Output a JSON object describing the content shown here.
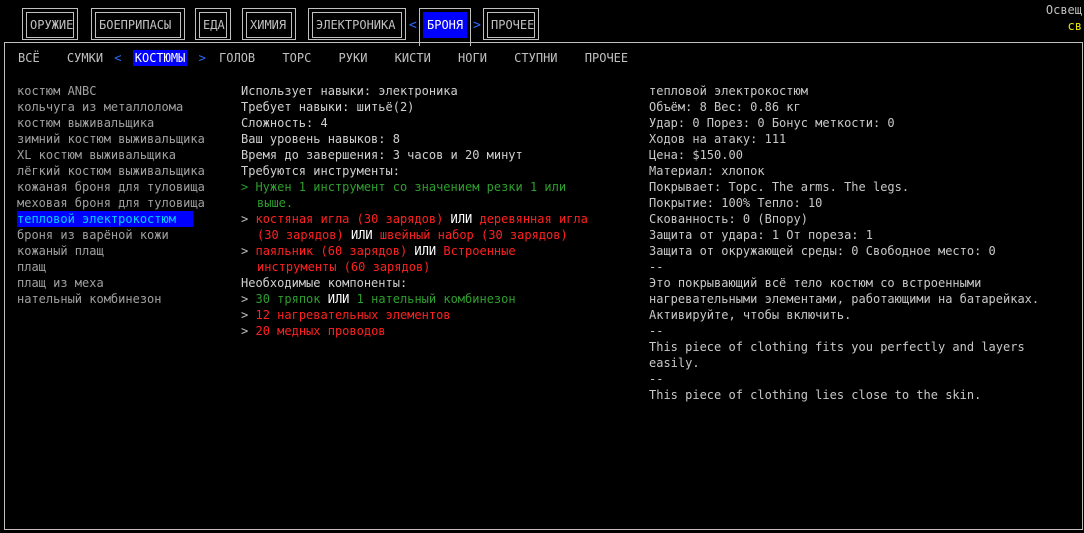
{
  "top_tabs": [
    {
      "label": "ОРУЖИЕ"
    },
    {
      "label": "БОЕПРИПАСЫ"
    },
    {
      "label": "ЕДА"
    },
    {
      "label": "ХИМИЯ"
    },
    {
      "label": "ЭЛЕКТРОНИКА"
    },
    {
      "label": "БРОНЯ",
      "active": true
    },
    {
      "label": "ПРОЧЕЕ"
    }
  ],
  "arrows": {
    "left": "<",
    "right": ">"
  },
  "top_right": {
    "line1": "Освещ",
    "line2": "св"
  },
  "sub_tabs": [
    "ВСЁ",
    "СУМКИ",
    "КОСТЮМЫ",
    "ГОЛОВ",
    "ТОРС",
    "РУКИ",
    "КИСТИ",
    "НОГИ",
    "СТУПНИ",
    "ПРОЧЕЕ"
  ],
  "recipes": [
    "костюм ANBC",
    "кольчуга из металлолома",
    "костюм выживальщика",
    "зимний костюм выживальщика",
    "XL костюм выживальщика",
    "лёгкий костюм выживальщика",
    "кожаная броня для туловища",
    "меховая броня для туловища",
    "тепловой электрокостюм",
    "броня из варёной кожи",
    "кожаный плащ",
    "плащ",
    "плащ из меха",
    "нательный комбинезон"
  ],
  "selected_index": 8,
  "details": {
    "uses_skills": "Использует навыки: электроника",
    "requires_skills": "Требует навыки: шитьё(2)",
    "difficulty": "Сложность: 4",
    "your_level": "Ваш уровень навыков: 8",
    "time": "Время до завершения: 3 часов и 20 минут",
    "tools_header": "Требуются инструменты:",
    "tool1": "> Нужен 1 инструмент со значением резки 1 или",
    "tool1_cont": "выше.",
    "tool2_a": "костяная игла (30 зарядов)",
    "tool2_b": "деревянная игла",
    "tool2_c": "(30 зарядов)",
    "tool2_d": "швейный набор (30 зарядов)",
    "tool3_a": "паяльник (60 зарядов)",
    "tool3_b": "Встроенные",
    "tool3_c": "инструменты (60 зарядов)",
    "or": "ИЛИ",
    "bullet": ">",
    "components_header": "Необходимые компоненты:",
    "comp1_a": "30 тряпок",
    "comp1_b": "1 нательный комбинезон",
    "comp2": "12 нагревательных элементов",
    "comp3": "20 медных проводов"
  },
  "info": {
    "name": "тепловой электрокостюм",
    "volume_weight": "Объём: 8   Вес: 0.86 кг",
    "damage": "Удар: 0 Порез: 0 Бонус меткости: 0",
    "moves": "Ходов на атаку: 111",
    "price": "Цена: $150.00",
    "material": "Материал: хлопок",
    "covers": "Покрывает: Торс. The arms. The legs.",
    "coverage": "Покрытие: 100%  Тепло: 10",
    "encumbrance": "Скованность: 0 (Впору)",
    "protection": "Защита от удара: 1   От пореза: 1",
    "env": "Защита от окружающей среды: 0   Свободное место: 0",
    "sep": "--",
    "description": "Это покрывающий всё тело костюм со встроенными нагревательными элементами, работающими на батарейках. Активируйте, чтобы включить.",
    "fit": "This piece of clothing fits you perfectly and layers easily.",
    "skin": "This piece of clothing lies close to the skin."
  }
}
